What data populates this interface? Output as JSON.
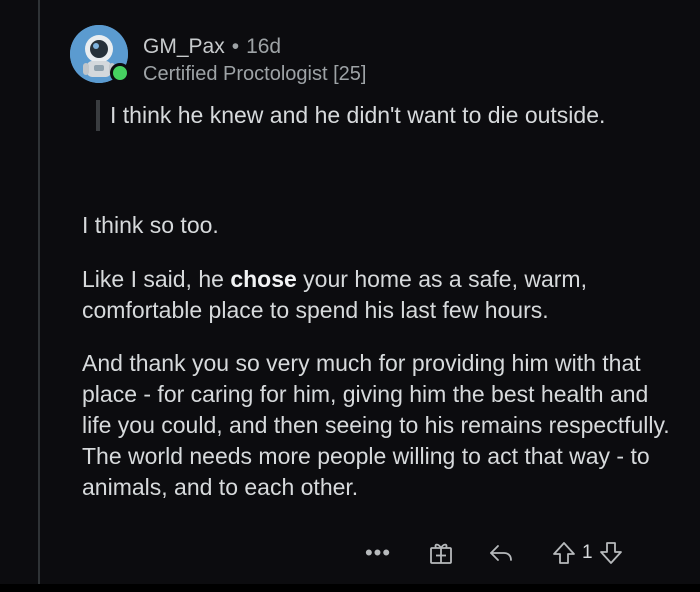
{
  "comment": {
    "username": "GM_Pax",
    "separator": "•",
    "age": "16d",
    "flair": "Certified Proctologist [25]",
    "quote": "I think he knew and he didn't want to die outside.",
    "paragraph1": "I think so too.",
    "paragraph2_before": "Like I said, he ",
    "paragraph2_bold": "chose",
    "paragraph2_after": " your home as a safe, warm, comfortable place to spend his last few hours.",
    "paragraph3": "And thank you so very much for providing him with that place - for caring for him, giving him the best health and life you could, and then seeing to his remains respectfully.  The world needs more people willing to act that way - to animals, and to each other."
  },
  "actions": {
    "more_label": "•••",
    "more_icon": "more-dots-icon",
    "award_icon": "award-gift-icon",
    "reply_icon": "reply-arrow-icon",
    "upvote_icon": "upvote-arrow-icon",
    "downvote_icon": "downvote-arrow-icon",
    "vote_count": "1"
  },
  "colors": {
    "background": "#0c0c0f",
    "text": "#d7dadc",
    "muted": "#9ea3a6",
    "online": "#46d160",
    "avatar_bg": "#5b9bd0"
  }
}
